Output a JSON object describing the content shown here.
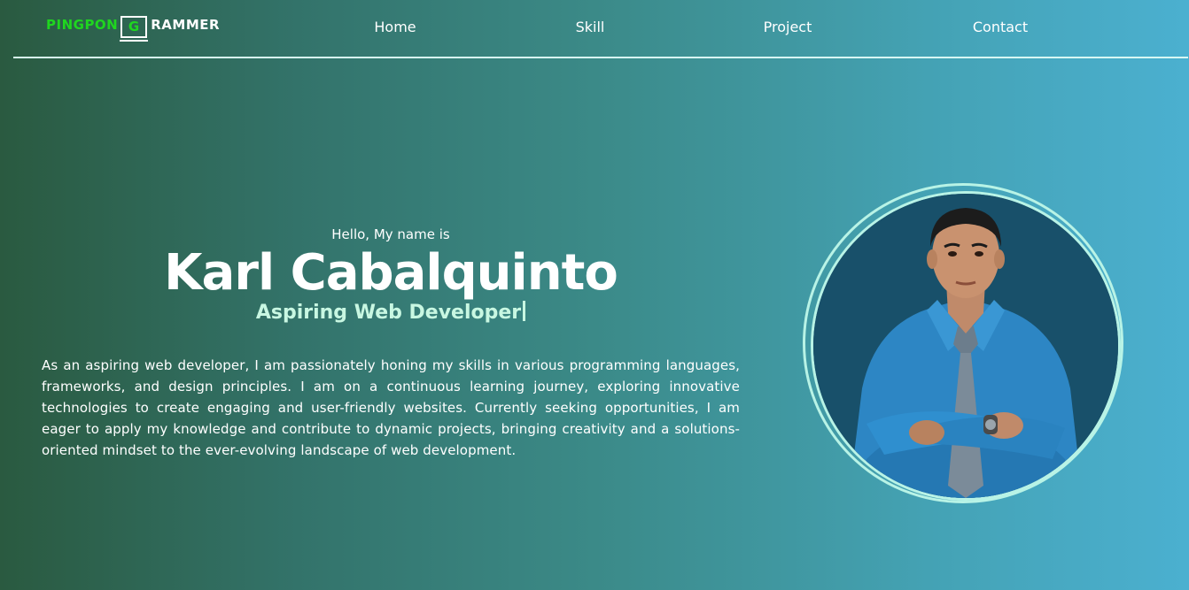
{
  "logo": {
    "part1": "PINGPON",
    "part2": "G",
    "part3": "RAMMER"
  },
  "nav": {
    "home": "Home",
    "skill": "Skill",
    "project": "Project",
    "contact": "Contact"
  },
  "hero": {
    "greeting": "Hello, My name is",
    "name": "Karl Cabalquinto",
    "role": "Aspiring Web Developer",
    "bio": "As an aspiring web developer, I am passionately honing my skills in various programming languages, frameworks, and design principles. I am on a continuous learning journey, exploring innovative technologies to create engaging and user-friendly websites. Currently seeking opportunities, I am eager to apply my knowledge and contribute to dynamic projects, bringing creativity and a solutions-oriented mindset to the ever-evolving landscape of web development."
  },
  "colors": {
    "background_start": "#2a5a40",
    "background_end": "#4bb0d0",
    "logo_green": "#1fd61f",
    "role_text": "#c8f7e2",
    "ring": "#b8f3e6",
    "photo_background": "#18506a"
  },
  "icons": {
    "profile_photo": "portrait-photo"
  }
}
